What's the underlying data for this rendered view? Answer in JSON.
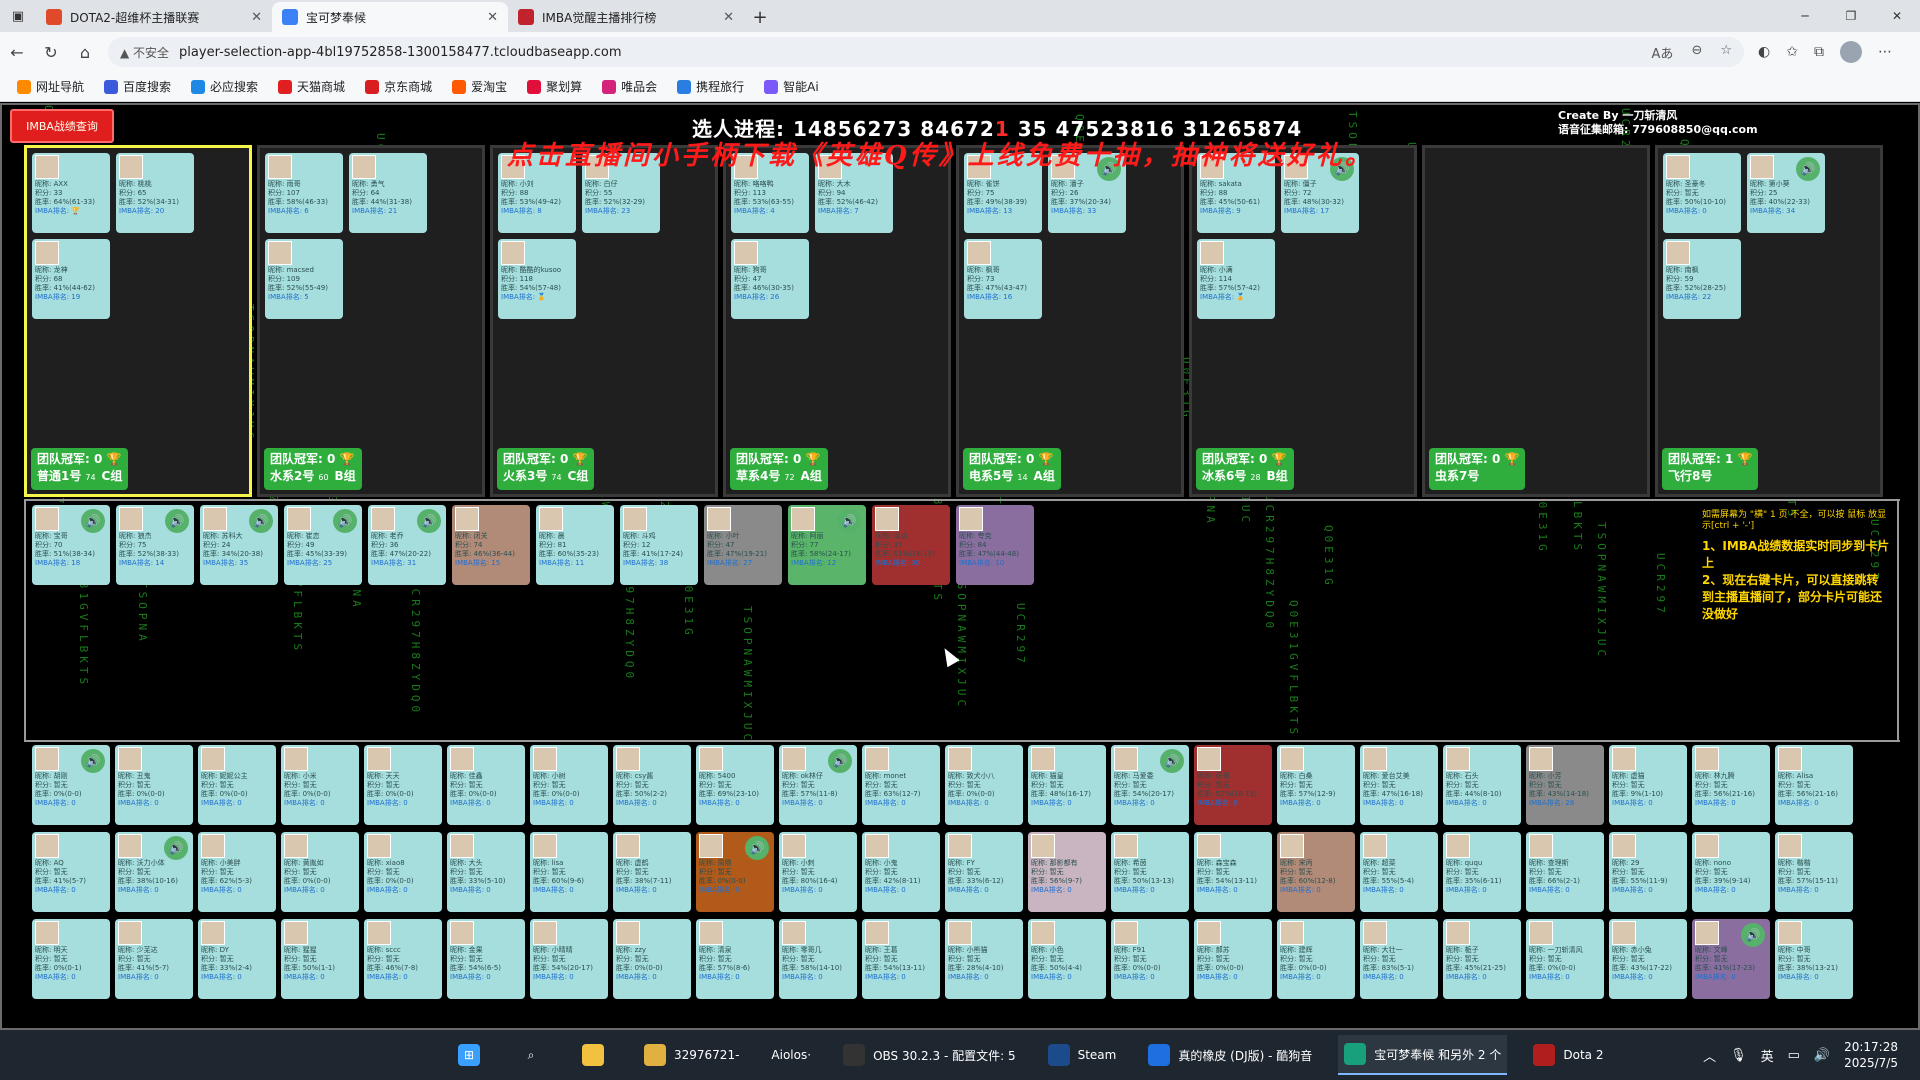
{
  "browser": {
    "tabs": [
      {
        "title": "DOTA2-超维杯主播联赛",
        "active": false,
        "fav_color": "#e04a2a"
      },
      {
        "title": "宝可梦奉候",
        "active": true,
        "fav_color": "#3b82f6"
      },
      {
        "title": "IMBA觉醒主播排行榜",
        "active": false,
        "fav_color": "#c0232c"
      }
    ],
    "new_tab": "+",
    "security_label": "▲ 不安全",
    "url": "player-selection-app-4bl19752858-1300158477.tcloudbaseapp.com",
    "bookmarks": [
      {
        "label": "网址导航",
        "color": "#ff8a00"
      },
      {
        "label": "百度搜索",
        "color": "#3b5bdb"
      },
      {
        "label": "必应搜索",
        "color": "#1e88e5"
      },
      {
        "label": "天猫商城",
        "color": "#e02020"
      },
      {
        "label": "京东商城",
        "color": "#d81e1e"
      },
      {
        "label": "爱淘宝",
        "color": "#ff5a00"
      },
      {
        "label": "聚划算",
        "color": "#e0103a"
      },
      {
        "label": "唯品会",
        "color": "#d4237a"
      },
      {
        "label": "携程旅行",
        "color": "#2a7de1"
      },
      {
        "label": "智能Ai",
        "color": "#7a5af8"
      }
    ]
  },
  "page": {
    "imba_button": "IMBA战绩查询",
    "progress_label": "选人进程:",
    "progress_values": "14856273 84672",
    "progress_mark": "1",
    "progress_values2": "35 47523816 31265874",
    "create_by": "Create By 一刀斩清风",
    "email": "语音征集邮箱: 779608850@qq.com",
    "promo": "点击直播间小手柄下载《英雄Q传》上线免费十抽，抽神将送好礼。",
    "teams": [
      {
        "champ": "团队冠军: 0 🏆",
        "name": "普通1号",
        "score": "74",
        "group": "C组",
        "selected": true,
        "players": [
          {
            "nick": "昵称: AXX",
            "pts": "积分: 33",
            "win": "胜率: 64%(61-33)",
            "rank": "IMBA排名: 🏆"
          },
          {
            "nick": "昵称: 桃桃",
            "pts": "积分: 65",
            "win": "胜率: 52%(34-31)",
            "rank": "IMBA排名: 20"
          },
          {
            "nick": "昵称: 龙神",
            "pts": "积分: 68",
            "win": "胜率: 41%(44-62)",
            "rank": "IMBA排名: 19"
          }
        ]
      },
      {
        "champ": "团队冠军: 0 🏆",
        "name": "水系2号",
        "score": "60",
        "group": "B组",
        "selected": false,
        "players": [
          {
            "nick": "昵称: 雨哥",
            "pts": "积分: 107",
            "win": "胜率: 58%(46-33)",
            "rank": "IMBA排名: 6"
          },
          {
            "nick": "昵称: 勇气",
            "pts": "积分: 64",
            "win": "胜率: 44%(31-38)",
            "rank": "IMBA排名: 21"
          },
          {
            "nick": "昵称: macsed",
            "pts": "积分: 109",
            "win": "胜率: 52%(55-49)",
            "rank": "IMBA排名: 5"
          }
        ]
      },
      {
        "champ": "团队冠军: 0 🏆",
        "name": "火系3号",
        "score": "74",
        "group": "C组",
        "selected": false,
        "players": [
          {
            "nick": "昵称: 小刘",
            "pts": "积分: 88",
            "win": "胜率: 53%(49-42)",
            "rank": "IMBA排名: 8"
          },
          {
            "nick": "昵称: 白仔",
            "pts": "积分: 55",
            "win": "胜率: 52%(32-29)",
            "rank": "IMBA排名: 23"
          },
          {
            "nick": "昵称: 酷酷的kusoo",
            "pts": "积分: 118",
            "win": "胜率: 54%(57-48)",
            "rank": "IMBA排名: 🏅"
          }
        ]
      },
      {
        "champ": "团队冠军: 0 🏆",
        "name": "草系4号",
        "score": "72",
        "group": "A组",
        "selected": false,
        "players": [
          {
            "nick": "昵称: 咯咯鸭",
            "pts": "积分: 113",
            "win": "胜率: 53%(63-55)",
            "rank": "IMBA排名: 4"
          },
          {
            "nick": "昵称: 大木",
            "pts": "积分: 94",
            "win": "胜率: 52%(46-42)",
            "rank": "IMBA排名: 7"
          },
          {
            "nick": "昵称: 狗哥",
            "pts": "积分: 47",
            "win": "胜率: 46%(30-35)",
            "rank": "IMBA排名: 26"
          }
        ]
      },
      {
        "champ": "团队冠军: 0 🏆",
        "name": "电系5号",
        "score": "14",
        "group": "A组",
        "selected": false,
        "players": [
          {
            "nick": "昵称: 雀饼",
            "pts": "积分: 75",
            "win": "胜率: 49%(38-39)",
            "rank": "IMBA排名: 13"
          },
          {
            "nick": "昵称: 潘子",
            "pts": "积分: 26",
            "win": "胜率: 37%(20-34)",
            "rank": "IMBA排名: 33"
          },
          {
            "nick": "昵称: 枫哥",
            "pts": "积分: 73",
            "win": "胜率: 47%(43-47)",
            "rank": "IMBA排名: 16"
          }
        ]
      },
      {
        "champ": "团队冠军: 0 🏆",
        "name": "冰系6号",
        "score": "28",
        "group": "B组",
        "selected": false,
        "players": [
          {
            "nick": "昵称: sakata",
            "pts": "积分: 88",
            "win": "胜率: 45%(50-61)",
            "rank": "IMBA排名: 9"
          },
          {
            "nick": "昵称: 僵子",
            "pts": "积分: 72",
            "win": "胜率: 48%(30-32)",
            "rank": "IMBA排名: 17"
          },
          {
            "nick": "昵称: 小满",
            "pts": "积分: 114",
            "win": "胜率: 57%(57-42)",
            "rank": "IMBA排名: 🏅"
          }
        ]
      },
      {
        "champ": "团队冠军: 0 🏆",
        "name": "虫系7号",
        "score": "",
        "group": "",
        "selected": false,
        "players": []
      },
      {
        "champ": "团队冠军: 1 🏆",
        "name": "飞行8号",
        "score": "",
        "group": "",
        "selected": false,
        "players": [
          {
            "nick": "昵称: 圣豪冬",
            "pts": "积分: 暂无",
            "win": "胜率: 50%(10-10)",
            "rank": "IMBA排名: 0"
          },
          {
            "nick": "昵称: 第小葵",
            "pts": "积分: 25",
            "win": "胜率: 40%(22-33)",
            "rank": "IMBA排名: 34"
          },
          {
            "nick": "昵称: 南枫",
            "pts": "积分: 59",
            "win": "胜率: 52%(28-25)",
            "rank": "IMBA排名: 22"
          }
        ]
      }
    ],
    "pool_row1": [
      {
        "nick": "昵称: 宝哥",
        "pts": "积分: 70",
        "win": "胜率: 51%(38-34)",
        "rank": "IMBA排名: 18",
        "style": ""
      },
      {
        "nick": "昵称: 狼杰",
        "pts": "积分: 75",
        "win": "胜率: 52%(38-33)",
        "rank": "IMBA排名: 14",
        "style": ""
      },
      {
        "nick": "昵称: 苏科大",
        "pts": "积分: 24",
        "win": "胜率: 34%(20-38)",
        "rank": "IMBA排名: 35",
        "style": ""
      },
      {
        "nick": "昵称: 崔恋",
        "pts": "积分: 49",
        "win": "胜率: 45%(33-39)",
        "rank": "IMBA排名: 25",
        "style": ""
      },
      {
        "nick": "昵称: 老乔",
        "pts": "积分: 36",
        "win": "胜率: 47%(20-22)",
        "rank": "IMBA排名: 31",
        "style": ""
      },
      {
        "nick": "昵称: 闭关",
        "pts": "积分: 74",
        "win": "胜率: 46%(36-44)",
        "rank": "IMBA排名: 15",
        "style": "brown"
      },
      {
        "nick": "昵称: 晨",
        "pts": "积分: 81",
        "win": "胜率: 60%(35-23)",
        "rank": "IMBA排名: 11",
        "style": ""
      },
      {
        "nick": "昵称: 斗鸡",
        "pts": "积分: 12",
        "win": "胜率: 41%(17-24)",
        "rank": "IMBA排名: 38",
        "style": ""
      },
      {
        "nick": "昵称: 小叶",
        "pts": "积分: 47",
        "win": "胜率: 47%(19-21)",
        "rank": "IMBA排名: 27",
        "style": "dark"
      },
      {
        "nick": "昵称: 阿丽",
        "pts": "积分: 77",
        "win": "胜率: 58%(24-17)",
        "rank": "IMBA排名: 12",
        "style": "green"
      },
      {
        "nick": "昵称: 淡淡",
        "pts": "积分: 37",
        "win": "胜率: 51%(16-15)",
        "rank": "IMBA排名: 30",
        "style": "red"
      },
      {
        "nick": "昵称: 夸克",
        "pts": "积分: 84",
        "win": "胜率: 47%(44-48)",
        "rank": "IMBA排名: 10",
        "style": "purple"
      }
    ],
    "pool_row2": [
      {
        "nick": "昵称: 胡刚",
        "pts": "积分: 暂无",
        "win": "胜率: 0%(0-0)",
        "rank": "IMBA排名: 0",
        "style": ""
      },
      {
        "nick": "昵称: 丑鬼",
        "pts": "积分: 暂无",
        "win": "胜率: 0%(0-0)",
        "rank": "IMBA排名: 0",
        "style": ""
      },
      {
        "nick": "昵称: 妮妮公主",
        "pts": "积分: 暂无",
        "win": "胜率: 0%(0-0)",
        "rank": "IMBA排名: 0",
        "style": ""
      },
      {
        "nick": "昵称: 小米",
        "pts": "积分: 暂无",
        "win": "胜率: 0%(0-0)",
        "rank": "IMBA排名: 0",
        "style": ""
      },
      {
        "nick": "昵称: 天天",
        "pts": "积分: 暂无",
        "win": "胜率: 0%(0-0)",
        "rank": "IMBA排名: 0",
        "style": ""
      },
      {
        "nick": "昵称: 佳鑫",
        "pts": "积分: 暂无",
        "win": "胜率: 0%(0-0)",
        "rank": "IMBA排名: 0",
        "style": ""
      },
      {
        "nick": "昵称: 小树",
        "pts": "积分: 暂无",
        "win": "胜率: 0%(0-0)",
        "rank": "IMBA排名: 0",
        "style": ""
      },
      {
        "nick": "昵称: csy酱",
        "pts": "积分: 暂无",
        "win": "胜率: 50%(2-2)",
        "rank": "IMBA排名: 0",
        "style": ""
      },
      {
        "nick": "昵称: 5400",
        "pts": "积分: 暂无",
        "win": "胜率: 69%(23-10)",
        "rank": "IMBA排名: 0",
        "style": ""
      },
      {
        "nick": "昵称: ok林仔",
        "pts": "积分: 暂无",
        "win": "胜率: 57%(11-8)",
        "rank": "IMBA排名: 0",
        "style": ""
      },
      {
        "nick": "昵称: monet",
        "pts": "积分: 暂无",
        "win": "胜率: 63%(12-7)",
        "rank": "IMBA排名: 0",
        "style": ""
      },
      {
        "nick": "昵称: 致犬小八",
        "pts": "积分: 暂无",
        "win": "胜率: 0%(0-0)",
        "rank": "IMBA排名: 0",
        "style": ""
      },
      {
        "nick": "昵称: 猫皇",
        "pts": "积分: 暂无",
        "win": "胜率: 48%(16-17)",
        "rank": "IMBA排名: 0",
        "style": ""
      },
      {
        "nick": "昵称: 马爱委",
        "pts": "积分: 暂无",
        "win": "胜率: 54%(20-17)",
        "rank": "IMBA排名: 0",
        "style": ""
      },
      {
        "nick": "昵称: 奇哥",
        "pts": "积分: 暂无",
        "win": "胜率: 52%(16-15)",
        "rank": "IMBA排名: 0",
        "style": "red"
      },
      {
        "nick": "昵称: 白桑",
        "pts": "积分: 暂无",
        "win": "胜率: 57%(12-9)",
        "rank": "IMBA排名: 0",
        "style": ""
      },
      {
        "nick": "昵称: 爱台艾美",
        "pts": "积分: 暂无",
        "win": "胜率: 47%(16-18)",
        "rank": "IMBA排名: 0",
        "style": ""
      },
      {
        "nick": "昵称: 石头",
        "pts": "积分: 暂无",
        "win": "胜率: 44%(8-10)",
        "rank": "IMBA排名: 0",
        "style": ""
      },
      {
        "nick": "昵称: 小芳",
        "pts": "积分: 暂无",
        "win": "胜率: 43%(14-18)",
        "rank": "IMBA排名: 28",
        "style": "dark"
      },
      {
        "nick": "昵称: 虚猫",
        "pts": "积分: 暂无",
        "win": "胜率: 9%(1-10)",
        "rank": "IMBA排名: 0",
        "style": ""
      },
      {
        "nick": "昵称: 林九腾",
        "pts": "积分: 暂无",
        "win": "胜率: 56%(21-16)",
        "rank": "IMBA排名: 0",
        "style": ""
      },
      {
        "nick": "昵称: Alisa",
        "pts": "积分: 暂无",
        "win": "胜率: 56%(21-16)",
        "rank": "IMBA排名: 0",
        "style": ""
      },
      {
        "nick": "昵称: AQ",
        "pts": "积分: 暂无",
        "win": "胜率: 41%(5-7)",
        "rank": "IMBA排名: 0",
        "style": ""
      },
      {
        "nick": "昵称: 沃力小体",
        "pts": "积分: 暂无",
        "win": "胜率: 38%(10-16)",
        "rank": "IMBA排名: 0",
        "style": ""
      },
      {
        "nick": "昵称: 小美胖",
        "pts": "积分: 暂无",
        "win": "胜率: 62%(5-3)",
        "rank": "IMBA排名: 0",
        "style": ""
      },
      {
        "nick": "昵称: 黄胤如",
        "pts": "积分: 暂无",
        "win": "胜率: 0%(0-0)",
        "rank": "IMBA排名: 0",
        "style": ""
      },
      {
        "nick": "昵称: xiao8",
        "pts": "积分: 暂无",
        "win": "胜率: 0%(0-0)",
        "rank": "IMBA排名: 0",
        "style": ""
      },
      {
        "nick": "昵称: 大头",
        "pts": "积分: 暂无",
        "win": "胜率: 33%(5-10)",
        "rank": "IMBA排名: 0",
        "style": ""
      },
      {
        "nick": "昵称: lisa",
        "pts": "积分: 暂无",
        "win": "胜率: 60%(9-6)",
        "rank": "IMBA排名: 0",
        "style": ""
      },
      {
        "nick": "昵称: 虚鹤",
        "pts": "积分: 暂无",
        "win": "胜率: 38%(7-11)",
        "rank": "IMBA排名: 0",
        "style": ""
      },
      {
        "nick": "昵称: 周鼎",
        "pts": "积分: 暂无",
        "win": "胜率: 0%(0-0)",
        "rank": "IMBA排名: 0",
        "style": "fire"
      },
      {
        "nick": "昵称: 小刺",
        "pts": "积分: 暂无",
        "win": "胜率: 80%(16-4)",
        "rank": "IMBA排名: 0",
        "style": ""
      },
      {
        "nick": "昵称: 小鬼",
        "pts": "积分: 暂无",
        "win": "胜率: 42%(8-11)",
        "rank": "IMBA排名: 0",
        "style": ""
      },
      {
        "nick": "昵称: FY",
        "pts": "积分: 暂无",
        "win": "胜率: 33%(6-12)",
        "rank": "IMBA排名: 0",
        "style": ""
      },
      {
        "nick": "昵称: 那影都有",
        "pts": "积分: 暂无",
        "win": "胜率: 56%(9-7)",
        "rank": "IMBA排名: 0",
        "style": "pink"
      },
      {
        "nick": "昵称: 希茵",
        "pts": "积分: 暂无",
        "win": "胜率: 50%(13-13)",
        "rank": "IMBA排名: 0",
        "style": ""
      },
      {
        "nick": "昵称: 森宝森",
        "pts": "积分: 暂无",
        "win": "胜率: 54%(13-11)",
        "rank": "IMBA排名: 0",
        "style": ""
      },
      {
        "nick": "昵称: 宋丙",
        "pts": "积分: 暂无",
        "win": "胜率: 60%(12-8)",
        "rank": "IMBA排名: 0",
        "style": "brown"
      },
      {
        "nick": "昵称: 超菜",
        "pts": "积分: 暂无",
        "win": "胜率: 55%(5-4)",
        "rank": "IMBA排名: 0",
        "style": ""
      },
      {
        "nick": "昵称: ququ",
        "pts": "积分: 暂无",
        "win": "胜率: 35%(6-11)",
        "rank": "IMBA排名: 0",
        "style": ""
      },
      {
        "nick": "昵称: 查理斯",
        "pts": "积分: 暂无",
        "win": "胜率: 66%(2-1)",
        "rank": "IMBA排名: 0",
        "style": ""
      },
      {
        "nick": "昵称: 29",
        "pts": "积分: 暂无",
        "win": "胜率: 55%(11-9)",
        "rank": "IMBA排名: 0",
        "style": ""
      },
      {
        "nick": "昵称: nono",
        "pts": "积分: 暂无",
        "win": "胜率: 39%(9-14)",
        "rank": "IMBA排名: 0",
        "style": ""
      },
      {
        "nick": "昵称: 楷楷",
        "pts": "积分: 暂无",
        "win": "胜率: 57%(15-11)",
        "rank": "IMBA排名: 0",
        "style": ""
      },
      {
        "nick": "昵称: 明天",
        "pts": "积分: 暂无",
        "win": "胜率: 0%(0-1)",
        "rank": "IMBA排名: 0",
        "style": ""
      },
      {
        "nick": "昵称: 少芜达",
        "pts": "积分: 暂无",
        "win": "胜率: 41%(5-7)",
        "rank": "IMBA排名: 0",
        "style": ""
      },
      {
        "nick": "昵称: DY",
        "pts": "积分: 暂无",
        "win": "胜率: 33%(2-4)",
        "rank": "IMBA排名: 0",
        "style": ""
      },
      {
        "nick": "昵称: 猩猩",
        "pts": "积分: 暂无",
        "win": "胜率: 50%(1-1)",
        "rank": "IMBA排名: 0",
        "style": ""
      },
      {
        "nick": "昵称: sccc",
        "pts": "积分: 暂无",
        "win": "胜率: 46%(7-8)",
        "rank": "IMBA排名: 0",
        "style": ""
      },
      {
        "nick": "昵称: 金果",
        "pts": "积分: 暂无",
        "win": "胜率: 54%(6-5)",
        "rank": "IMBA排名: 0",
        "style": ""
      },
      {
        "nick": "昵称: 小晴晴",
        "pts": "积分: 暂无",
        "win": "胜率: 54%(20-17)",
        "rank": "IMBA排名: 0",
        "style": ""
      },
      {
        "nick": "昵称: zzy",
        "pts": "积分: 暂无",
        "win": "胜率: 0%(0-0)",
        "rank": "IMBA排名: 0",
        "style": ""
      },
      {
        "nick": "昵称: 清泉",
        "pts": "积分: 暂无",
        "win": "胜率: 57%(8-6)",
        "rank": "IMBA排名: 0",
        "style": ""
      },
      {
        "nick": "昵称: 零哥几",
        "pts": "积分: 暂无",
        "win": "胜率: 58%(14-10)",
        "rank": "IMBA排名: 0",
        "style": ""
      },
      {
        "nick": "昵称: 王葛",
        "pts": "积分: 暂无",
        "win": "胜率: 54%(13-11)",
        "rank": "IMBA排名: 0",
        "style": ""
      },
      {
        "nick": "昵称: 小熊猫",
        "pts": "积分: 暂无",
        "win": "胜率: 28%(4-10)",
        "rank": "IMBA排名: 0",
        "style": ""
      },
      {
        "nick": "昵称: 小色",
        "pts": "积分: 暂无",
        "win": "胜率: 50%(4-4)",
        "rank": "IMBA排名: 0",
        "style": ""
      },
      {
        "nick": "昵称: F91",
        "pts": "积分: 暂无",
        "win": "胜率: 0%(0-0)",
        "rank": "IMBA排名: 0",
        "style": ""
      },
      {
        "nick": "昵称: 郝苏",
        "pts": "积分: 暂无",
        "win": "胜率: 0%(0-0)",
        "rank": "IMBA排名: 0",
        "style": ""
      },
      {
        "nick": "昵称: 建辉",
        "pts": "积分: 暂无",
        "win": "胜率: 0%(0-0)",
        "rank": "IMBA排名: 0",
        "style": ""
      },
      {
        "nick": "昵称: 大壮一",
        "pts": "积分: 暂无",
        "win": "胜率: 83%(5-1)",
        "rank": "IMBA排名: 0",
        "style": ""
      },
      {
        "nick": "昵称: 栀子",
        "pts": "积分: 暂无",
        "win": "胜率: 45%(21-25)",
        "rank": "IMBA排名: 0",
        "style": ""
      },
      {
        "nick": "昵称: 一刀斩清风",
        "pts": "积分: 暂无",
        "win": "胜率: 0%(0-0)",
        "rank": "IMBA排名: 0",
        "style": ""
      },
      {
        "nick": "昵称: 赤小兔",
        "pts": "积分: 暂无",
        "win": "胜率: 43%(17-22)",
        "rank": "IMBA排名: 0",
        "style": ""
      },
      {
        "nick": "昵称: 文峰",
        "pts": "积分: 暂无",
        "win": "胜率: 41%(17-23)",
        "rank": "IMBA排名: 0",
        "style": "purple"
      },
      {
        "nick": "昵称: 中哥",
        "pts": "积分: 暂无",
        "win": "胜率: 38%(13-21)",
        "rank": "IMBA排名: 0",
        "style": ""
      }
    ],
    "notes_small": "如需屏幕为 \"横\" 1 页 不全，可以按 鼠标 放显示[ctrl + '-']",
    "note1": "1、IMBA战绩数据实时同步到卡片上",
    "note2": "2、现在右键卡片，可以直接跳转到主播直播间了，部分卡片可能还没做好"
  },
  "taskbar": {
    "items": [
      {
        "label": "",
        "icon": "windows-start-icon",
        "color": "#3aa0ff"
      },
      {
        "label": "",
        "icon": "search-icon",
        "color": "#1e2630"
      },
      {
        "label": "",
        "icon": "folder-icon",
        "color": "#f3c140"
      },
      {
        "label": "32976721-",
        "icon": "owl-icon",
        "color": "#e0b040"
      },
      {
        "label": "Aiolos·",
        "icon": "",
        "color": ""
      },
      {
        "label": "OBS 30.2.3 - 配置文件: 5",
        "icon": "obs-icon",
        "color": "#333"
      },
      {
        "label": "Steam",
        "icon": "steam-icon",
        "color": "#1b4b8a"
      },
      {
        "label": "真的橡皮 (DJ版) - 酷狗音",
        "icon": "kugou-icon",
        "color": "#1e6fe0"
      },
      {
        "label": "宝可梦奉候 和另外 2 个",
        "icon": "edge-icon",
        "color": "#18a07a"
      },
      {
        "label": "Dota 2",
        "icon": "dota-icon",
        "color": "#b01e1e"
      }
    ],
    "ime": "英",
    "time": "20:17:28",
    "date": "2025/7/5"
  }
}
